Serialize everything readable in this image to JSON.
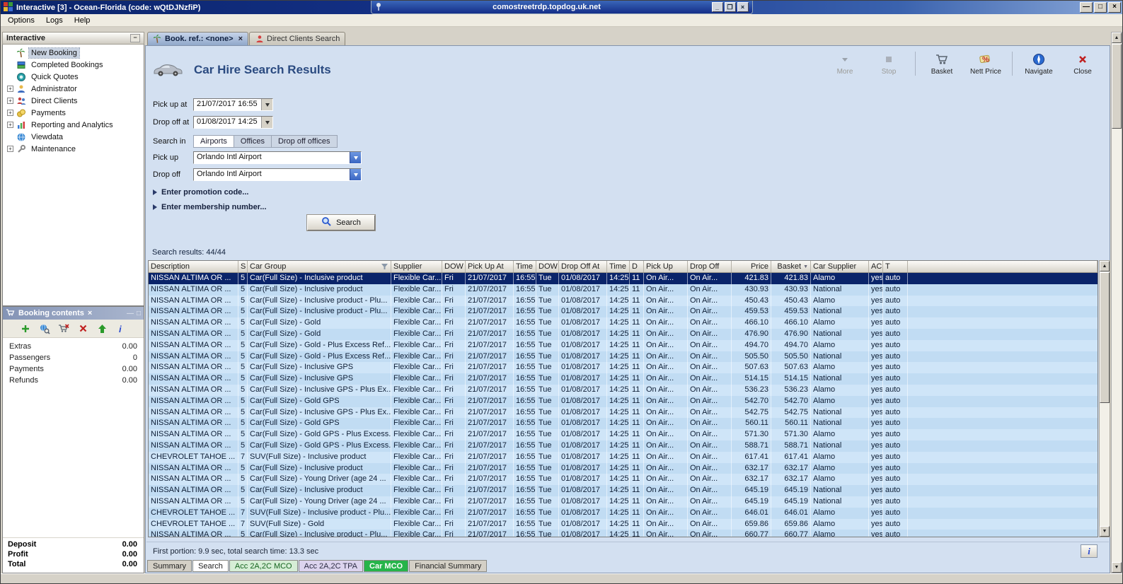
{
  "window": {
    "title": "Interactive [3] - Ocean-Florida (code: wQtDJNzfiP)",
    "rdp_title": "comostreetrdp.topdog.uk.net",
    "buttons": {
      "minimize": "—",
      "maximize": "□",
      "close": "×"
    }
  },
  "menubar": {
    "items": [
      "Options",
      "Logs",
      "Help"
    ]
  },
  "sidebar": {
    "title": "Interactive",
    "items": [
      {
        "label": "New Booking",
        "icon": "palm-icon",
        "expand": false,
        "selected": true
      },
      {
        "label": "Completed Bookings",
        "icon": "bookings-icon",
        "expand": false,
        "selected": false
      },
      {
        "label": "Quick Quotes",
        "icon": "quotes-icon",
        "expand": false,
        "selected": false
      },
      {
        "label": "Administrator",
        "icon": "admin-icon",
        "expand": true,
        "selected": false
      },
      {
        "label": "Direct Clients",
        "icon": "clients-icon",
        "expand": true,
        "selected": false
      },
      {
        "label": "Payments",
        "icon": "payments-icon",
        "expand": true,
        "selected": false
      },
      {
        "label": "Reporting and Analytics",
        "icon": "reports-icon",
        "expand": true,
        "selected": false
      },
      {
        "label": "Viewdata",
        "icon": "viewdata-icon",
        "expand": false,
        "selected": false
      },
      {
        "label": "Maintenance",
        "icon": "maintenance-icon",
        "expand": true,
        "selected": false
      }
    ]
  },
  "booking_panel": {
    "title": "Booking contents",
    "toolbar": [
      "add-icon",
      "globe-search-icon",
      "basket-remove-icon",
      "delete-icon",
      "arrow-up-icon",
      "info-icon"
    ],
    "rows": [
      {
        "label": "Extras",
        "value": "0.00"
      },
      {
        "label": "Passengers",
        "value": "0"
      },
      {
        "label": "Payments",
        "value": "0.00"
      },
      {
        "label": "Refunds",
        "value": "0.00"
      }
    ],
    "totals": [
      {
        "label": "Deposit",
        "value": "0.00"
      },
      {
        "label": "Profit",
        "value": "0.00"
      },
      {
        "label": "Total",
        "value": "0.00"
      }
    ]
  },
  "tabs": [
    {
      "label": "Book. ref.: <none>",
      "icon": "palm-icon",
      "active": true,
      "closable": true
    },
    {
      "label": "Direct Clients Search",
      "icon": "person-red-icon",
      "active": false,
      "closable": false
    }
  ],
  "page": {
    "title": "Car Hire Search Results",
    "toolbar": [
      {
        "label": "More",
        "icon": "more-icon",
        "disabled": true
      },
      {
        "label": "Stop",
        "icon": "stop-icon",
        "disabled": true
      },
      {
        "label": "Basket",
        "icon": "basket-icon",
        "disabled": false
      },
      {
        "label": "Nett Price",
        "icon": "nett-price-icon",
        "disabled": false
      },
      {
        "label": "Navigate",
        "icon": "navigate-icon",
        "disabled": false
      },
      {
        "label": "Close",
        "icon": "close-icon",
        "disabled": false
      }
    ]
  },
  "form": {
    "pickup_at": {
      "label": "Pick up at",
      "value": "21/07/2017 16:55"
    },
    "dropoff_at": {
      "label": "Drop off at",
      "value": "01/08/2017 14:25"
    },
    "search_in": {
      "label": "Search in",
      "options": [
        "Airports",
        "Offices",
        "Drop off offices"
      ],
      "selected": "Airports"
    },
    "pickup": {
      "label": "Pick up",
      "value": "Orlando Intl Airport"
    },
    "dropoff": {
      "label": "Drop off",
      "value": "Orlando Intl Airport"
    },
    "promo_toggle": "Enter promotion code...",
    "membership_toggle": "Enter membership number...",
    "search_button": "Search"
  },
  "results": {
    "summary": "Search results: 44/44",
    "footer": "First portion: 9.9 sec, total search time: 13.3 sec",
    "info_button": "i",
    "selected_row": 0,
    "columns": [
      "Description",
      "S",
      "Car Group",
      "Supplier",
      "DOW",
      "Pick Up At",
      "Time",
      "DOW",
      "Drop Off At",
      "Time",
      "D",
      "Pick Up",
      "Drop Off",
      "Price",
      "Basket",
      "Car Supplier",
      "AC",
      "T"
    ],
    "rows": [
      [
        "NISSAN ALTIMA OR ...",
        "5",
        "Car(Full Size) - Inclusive product",
        "Flexible Car...",
        "Fri",
        "21/07/2017",
        "16:55",
        "Tue",
        "01/08/2017",
        "14:25",
        "11",
        "On Air...",
        "On Air...",
        "421.83",
        "421.83",
        "Alamo",
        "yes",
        "auto"
      ],
      [
        "NISSAN ALTIMA OR ...",
        "5",
        "Car(Full Size) - Inclusive product",
        "Flexible Car...",
        "Fri",
        "21/07/2017",
        "16:55",
        "Tue",
        "01/08/2017",
        "14:25",
        "11",
        "On Air...",
        "On Air...",
        "430.93",
        "430.93",
        "National",
        "yes",
        "auto"
      ],
      [
        "NISSAN ALTIMA OR ...",
        "5",
        "Car(Full Size) - Inclusive product - Plu...",
        "Flexible Car...",
        "Fri",
        "21/07/2017",
        "16:55",
        "Tue",
        "01/08/2017",
        "14:25",
        "11",
        "On Air...",
        "On Air...",
        "450.43",
        "450.43",
        "Alamo",
        "yes",
        "auto"
      ],
      [
        "NISSAN ALTIMA OR ...",
        "5",
        "Car(Full Size) - Inclusive product - Plu...",
        "Flexible Car...",
        "Fri",
        "21/07/2017",
        "16:55",
        "Tue",
        "01/08/2017",
        "14:25",
        "11",
        "On Air...",
        "On Air...",
        "459.53",
        "459.53",
        "National",
        "yes",
        "auto"
      ],
      [
        "NISSAN ALTIMA OR ...",
        "5",
        "Car(Full Size) - Gold",
        "Flexible Car...",
        "Fri",
        "21/07/2017",
        "16:55",
        "Tue",
        "01/08/2017",
        "14:25",
        "11",
        "On Air...",
        "On Air...",
        "466.10",
        "466.10",
        "Alamo",
        "yes",
        "auto"
      ],
      [
        "NISSAN ALTIMA OR ...",
        "5",
        "Car(Full Size) - Gold",
        "Flexible Car...",
        "Fri",
        "21/07/2017",
        "16:55",
        "Tue",
        "01/08/2017",
        "14:25",
        "11",
        "On Air...",
        "On Air...",
        "476.90",
        "476.90",
        "National",
        "yes",
        "auto"
      ],
      [
        "NISSAN ALTIMA OR ...",
        "5",
        "Car(Full Size) - Gold - Plus Excess Ref...",
        "Flexible Car...",
        "Fri",
        "21/07/2017",
        "16:55",
        "Tue",
        "01/08/2017",
        "14:25",
        "11",
        "On Air...",
        "On Air...",
        "494.70",
        "494.70",
        "Alamo",
        "yes",
        "auto"
      ],
      [
        "NISSAN ALTIMA OR ...",
        "5",
        "Car(Full Size) - Gold - Plus Excess Ref...",
        "Flexible Car...",
        "Fri",
        "21/07/2017",
        "16:55",
        "Tue",
        "01/08/2017",
        "14:25",
        "11",
        "On Air...",
        "On Air...",
        "505.50",
        "505.50",
        "National",
        "yes",
        "auto"
      ],
      [
        "NISSAN ALTIMA OR ...",
        "5",
        "Car(Full Size) - Inclusive GPS",
        "Flexible Car...",
        "Fri",
        "21/07/2017",
        "16:55",
        "Tue",
        "01/08/2017",
        "14:25",
        "11",
        "On Air...",
        "On Air...",
        "507.63",
        "507.63",
        "Alamo",
        "yes",
        "auto"
      ],
      [
        "NISSAN ALTIMA OR ...",
        "5",
        "Car(Full Size) - Inclusive GPS",
        "Flexible Car...",
        "Fri",
        "21/07/2017",
        "16:55",
        "Tue",
        "01/08/2017",
        "14:25",
        "11",
        "On Air...",
        "On Air...",
        "514.15",
        "514.15",
        "National",
        "yes",
        "auto"
      ],
      [
        "NISSAN ALTIMA OR ...",
        "5",
        "Car(Full Size) - Inclusive GPS - Plus Ex...",
        "Flexible Car...",
        "Fri",
        "21/07/2017",
        "16:55",
        "Tue",
        "01/08/2017",
        "14:25",
        "11",
        "On Air...",
        "On Air...",
        "536.23",
        "536.23",
        "Alamo",
        "yes",
        "auto"
      ],
      [
        "NISSAN ALTIMA OR ...",
        "5",
        "Car(Full Size) - Gold GPS",
        "Flexible Car...",
        "Fri",
        "21/07/2017",
        "16:55",
        "Tue",
        "01/08/2017",
        "14:25",
        "11",
        "On Air...",
        "On Air...",
        "542.70",
        "542.70",
        "Alamo",
        "yes",
        "auto"
      ],
      [
        "NISSAN ALTIMA OR ...",
        "5",
        "Car(Full Size) - Inclusive GPS - Plus Ex...",
        "Flexible Car...",
        "Fri",
        "21/07/2017",
        "16:55",
        "Tue",
        "01/08/2017",
        "14:25",
        "11",
        "On Air...",
        "On Air...",
        "542.75",
        "542.75",
        "National",
        "yes",
        "auto"
      ],
      [
        "NISSAN ALTIMA OR ...",
        "5",
        "Car(Full Size) - Gold GPS",
        "Flexible Car...",
        "Fri",
        "21/07/2017",
        "16:55",
        "Tue",
        "01/08/2017",
        "14:25",
        "11",
        "On Air...",
        "On Air...",
        "560.11",
        "560.11",
        "National",
        "yes",
        "auto"
      ],
      [
        "NISSAN ALTIMA OR ...",
        "5",
        "Car(Full Size) - Gold GPS - Plus Excess...",
        "Flexible Car...",
        "Fri",
        "21/07/2017",
        "16:55",
        "Tue",
        "01/08/2017",
        "14:25",
        "11",
        "On Air...",
        "On Air...",
        "571.30",
        "571.30",
        "Alamo",
        "yes",
        "auto"
      ],
      [
        "NISSAN ALTIMA OR ...",
        "5",
        "Car(Full Size) - Gold GPS - Plus Excess...",
        "Flexible Car...",
        "Fri",
        "21/07/2017",
        "16:55",
        "Tue",
        "01/08/2017",
        "14:25",
        "11",
        "On Air...",
        "On Air...",
        "588.71",
        "588.71",
        "National",
        "yes",
        "auto"
      ],
      [
        "CHEVROLET TAHOE ...",
        "7",
        "SUV(Full Size) - Inclusive product",
        "Flexible Car...",
        "Fri",
        "21/07/2017",
        "16:55",
        "Tue",
        "01/08/2017",
        "14:25",
        "11",
        "On Air...",
        "On Air...",
        "617.41",
        "617.41",
        "Alamo",
        "yes",
        "auto"
      ],
      [
        "NISSAN ALTIMA OR ...",
        "5",
        "Car(Full Size) - Inclusive product",
        "Flexible Car...",
        "Fri",
        "21/07/2017",
        "16:55",
        "Tue",
        "01/08/2017",
        "14:25",
        "11",
        "On Air...",
        "On Air...",
        "632.17",
        "632.17",
        "Alamo",
        "yes",
        "auto"
      ],
      [
        "NISSAN ALTIMA OR ...",
        "5",
        "Car(Full Size) - Young Driver (age 24 ...",
        "Flexible Car...",
        "Fri",
        "21/07/2017",
        "16:55",
        "Tue",
        "01/08/2017",
        "14:25",
        "11",
        "On Air...",
        "On Air...",
        "632.17",
        "632.17",
        "Alamo",
        "yes",
        "auto"
      ],
      [
        "NISSAN ALTIMA OR ...",
        "5",
        "Car(Full Size) - Inclusive product",
        "Flexible Car...",
        "Fri",
        "21/07/2017",
        "16:55",
        "Tue",
        "01/08/2017",
        "14:25",
        "11",
        "On Air...",
        "On Air...",
        "645.19",
        "645.19",
        "National",
        "yes",
        "auto"
      ],
      [
        "NISSAN ALTIMA OR ...",
        "5",
        "Car(Full Size) - Young Driver (age 24 ...",
        "Flexible Car...",
        "Fri",
        "21/07/2017",
        "16:55",
        "Tue",
        "01/08/2017",
        "14:25",
        "11",
        "On Air...",
        "On Air...",
        "645.19",
        "645.19",
        "National",
        "yes",
        "auto"
      ],
      [
        "CHEVROLET TAHOE ...",
        "7",
        "SUV(Full Size) - Inclusive product - Plu...",
        "Flexible Car...",
        "Fri",
        "21/07/2017",
        "16:55",
        "Tue",
        "01/08/2017",
        "14:25",
        "11",
        "On Air...",
        "On Air...",
        "646.01",
        "646.01",
        "Alamo",
        "yes",
        "auto"
      ],
      [
        "CHEVROLET TAHOE ...",
        "7",
        "SUV(Full Size) - Gold",
        "Flexible Car...",
        "Fri",
        "21/07/2017",
        "16:55",
        "Tue",
        "01/08/2017",
        "14:25",
        "11",
        "On Air...",
        "On Air...",
        "659.86",
        "659.86",
        "Alamo",
        "yes",
        "auto"
      ],
      [
        "NISSAN ALTIMA OR ...",
        "5",
        "Car(Full Size) - Inclusive product - Plu...",
        "Flexible Car...",
        "Fri",
        "21/07/2017",
        "16:55",
        "Tue",
        "01/08/2017",
        "14:25",
        "11",
        "On Air...",
        "On Air...",
        "660.77",
        "660.77",
        "Alamo",
        "yes",
        "auto"
      ]
    ]
  },
  "bottom_tabs": [
    {
      "label": "Summary",
      "style": "plain"
    },
    {
      "label": "Search",
      "style": "white"
    },
    {
      "label": "Acc 2A,2C MCO",
      "style": "green-light"
    },
    {
      "label": "Acc 2A,2C TPA",
      "style": "lavender"
    },
    {
      "label": "Car MCO",
      "style": "green-solid"
    },
    {
      "label": "Financial Summary",
      "style": "plain"
    }
  ],
  "colors": {
    "selected_row": "#0a246a",
    "row_even": "#cfe5f8",
    "row_odd": "#c1dcf3",
    "titlebar": "#0a246a",
    "content_bg": "#d3e0f1"
  }
}
